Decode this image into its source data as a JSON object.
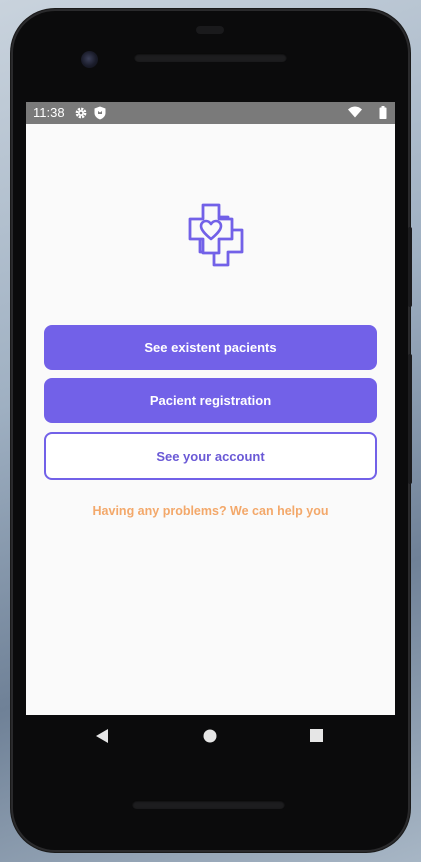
{
  "status_bar": {
    "time": "11:38",
    "icons": [
      "gear-icon",
      "shield-icon",
      "wifi-icon",
      "battery-icon"
    ]
  },
  "app": {
    "logo_icon": "medical-cross-heart-icon",
    "accent_color": "#7261e8",
    "help_color": "#f3a86a"
  },
  "buttons": {
    "see_patients": "See existent pacients",
    "registration": "Pacient registration",
    "account": "See your account"
  },
  "help": {
    "text": "Having any problems? We can help you"
  },
  "navigation": {
    "icons": [
      "back-triangle-icon",
      "home-circle-icon",
      "recents-square-icon"
    ]
  }
}
